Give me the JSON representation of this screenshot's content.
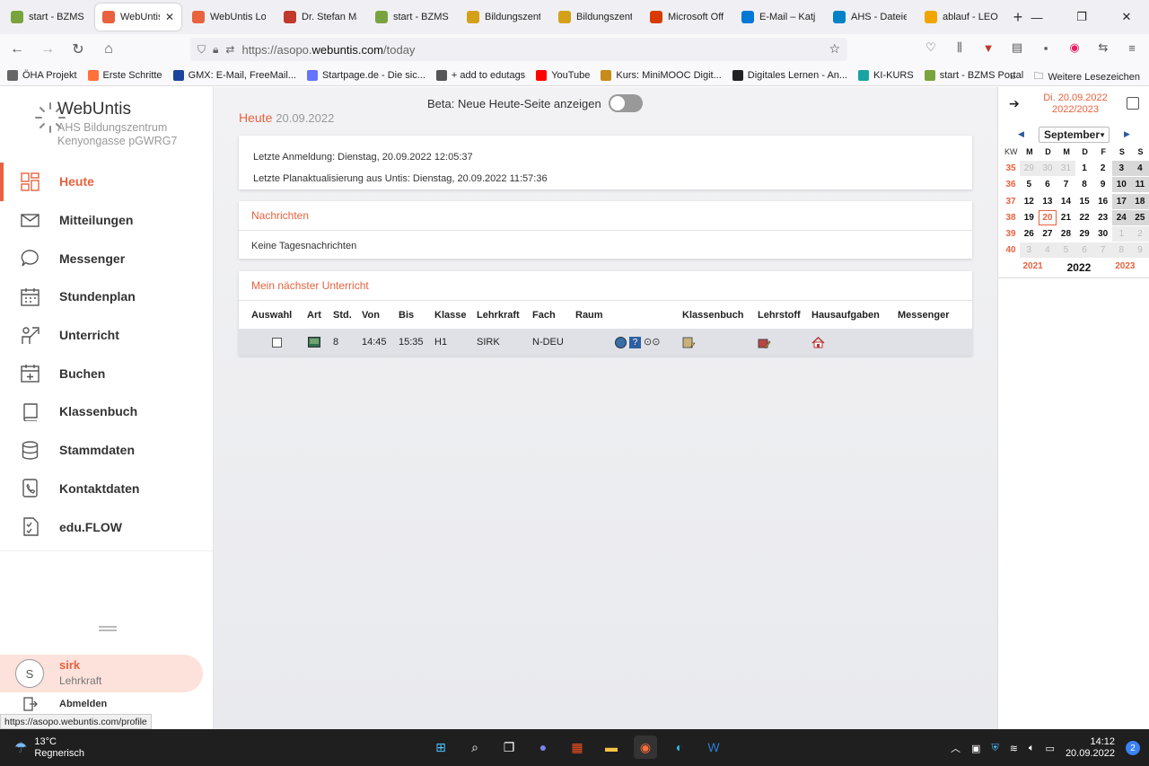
{
  "browser": {
    "tabs": [
      {
        "title": "start - BZMS P",
        "color": "#7aa33f"
      },
      {
        "title": "WebUntis",
        "color": "#e8623e",
        "active": true
      },
      {
        "title": "WebUntis Log",
        "color": "#e8623e"
      },
      {
        "title": "Dr. Stefan Ma",
        "color": "#c0392b"
      },
      {
        "title": "start - BZMS P",
        "color": "#7aa33f"
      },
      {
        "title": "Bildungszentr",
        "color": "#d4a017"
      },
      {
        "title": "Bildungszentr",
        "color": "#d4a017"
      },
      {
        "title": "Microsoft Offi",
        "color": "#d83b01"
      },
      {
        "title": "E-Mail – Katja",
        "color": "#0078d4"
      },
      {
        "title": "AHS - Dateien",
        "color": "#0082c9"
      },
      {
        "title": "ablauf - LEO.",
        "color": "#f0a500"
      }
    ],
    "close_glyph": "✕",
    "new_tab_glyph": "+",
    "url_prefix": "https://asopo.",
    "url_domain": "webuntis.com",
    "url_path": "/today",
    "bookmarks": [
      {
        "label": "ÖHA Projekt",
        "icon": "folder-icon"
      },
      {
        "label": "Erste Schritte",
        "icon": "firefox-icon"
      },
      {
        "label": "GMX: E-Mail, FreeMail...",
        "icon": "gmx-icon"
      },
      {
        "label": "Startpage.de - Die sic...",
        "icon": "startpage-icon"
      },
      {
        "label": "+ add to edutags",
        "icon": "globe-icon"
      },
      {
        "label": "YouTube",
        "icon": "youtube-icon"
      },
      {
        "label": "Kurs: MiniMOOC Digit...",
        "icon": "mooc-icon"
      },
      {
        "label": "Digitales Lernen - An...",
        "icon": "digital-icon"
      },
      {
        "label": "KI-KURS",
        "icon": "ki-icon"
      },
      {
        "label": "start - BZMS Portal",
        "icon": "bzms-icon"
      }
    ],
    "bookmarks_more": "Weitere Lesezeichen"
  },
  "sidebar": {
    "brand": "WebUntis",
    "school_line1": "AHS Bildungszentrum",
    "school_line2": "Kenyongasse pGWRG7",
    "menu": [
      {
        "label": "Heute",
        "icon": "dashboard-icon",
        "active": true
      },
      {
        "label": "Mitteilungen",
        "icon": "mail-icon"
      },
      {
        "label": "Messenger",
        "icon": "chat-icon"
      },
      {
        "label": "Stundenplan",
        "icon": "calendar-icon"
      },
      {
        "label": "Unterricht",
        "icon": "teacher-icon"
      },
      {
        "label": "Buchen",
        "icon": "calendar-plus-icon"
      },
      {
        "label": "Klassenbuch",
        "icon": "book-icon"
      },
      {
        "label": "Stammdaten",
        "icon": "database-icon"
      },
      {
        "label": "Kontaktdaten",
        "icon": "contact-icon"
      },
      {
        "label": "edu.FLOW",
        "icon": "checklist-icon"
      }
    ],
    "user": {
      "initial": "S",
      "name": "sirk",
      "role": "Lehrkraft"
    },
    "logout": "Abmelden",
    "status_url": "https://asopo.webuntis.com/profile"
  },
  "main": {
    "beta_label": "Beta: Neue Heute-Seite anzeigen",
    "title": "Heute",
    "date": "20.09.2022",
    "last_login": "Letzte Anmeldung: Dienstag, 20.09.2022 12:05:37",
    "last_update": "Letzte Planaktualisierung aus Untis: Dienstag, 20.09.2022 11:57:36",
    "news_title": "Nachrichten",
    "news_empty": "Keine Tagesnachrichten",
    "lesson_title": "Mein nächster Unterricht",
    "lesson_columns": [
      "Auswahl",
      "Art",
      "Std.",
      "Von",
      "Bis",
      "Klasse",
      "Lehrkraft",
      "Fach",
      "Raum",
      "Klassenbuch",
      "Lehrstoff",
      "Hausaufgaben",
      "Messenger"
    ],
    "lesson_row": {
      "std": "8",
      "von": "14:45",
      "bis": "15:35",
      "klasse": "H1",
      "lehrkraft": "SIRK",
      "fach": "N-DEU"
    }
  },
  "calendar": {
    "date_line1": "Di. 20.09.2022",
    "date_line2": "2022/2023",
    "month": "September",
    "kw_label": "KW",
    "weekdays": [
      "M",
      "D",
      "M",
      "D",
      "F",
      "S",
      "S"
    ],
    "weeks": [
      {
        "kw": "35",
        "days": [
          "29",
          "30",
          "31",
          "1",
          "2",
          "3",
          "4"
        ]
      },
      {
        "kw": "36",
        "days": [
          "5",
          "6",
          "7",
          "8",
          "9",
          "10",
          "11"
        ]
      },
      {
        "kw": "37",
        "days": [
          "12",
          "13",
          "14",
          "15",
          "16",
          "17",
          "18"
        ]
      },
      {
        "kw": "38",
        "days": [
          "19",
          "20",
          "21",
          "22",
          "23",
          "24",
          "25"
        ]
      },
      {
        "kw": "39",
        "days": [
          "26",
          "27",
          "28",
          "29",
          "30",
          "1",
          "2"
        ]
      },
      {
        "kw": "40",
        "days": [
          "3",
          "4",
          "5",
          "6",
          "7",
          "8",
          "9"
        ]
      }
    ],
    "years": [
      "2021",
      "2022",
      "2023"
    ]
  },
  "taskbar": {
    "temp": "13°C",
    "weather": "Regnerisch",
    "time": "14:12",
    "date": "20.09.2022",
    "notifications": "2"
  },
  "colors": {
    "accent": "#e8623e"
  }
}
